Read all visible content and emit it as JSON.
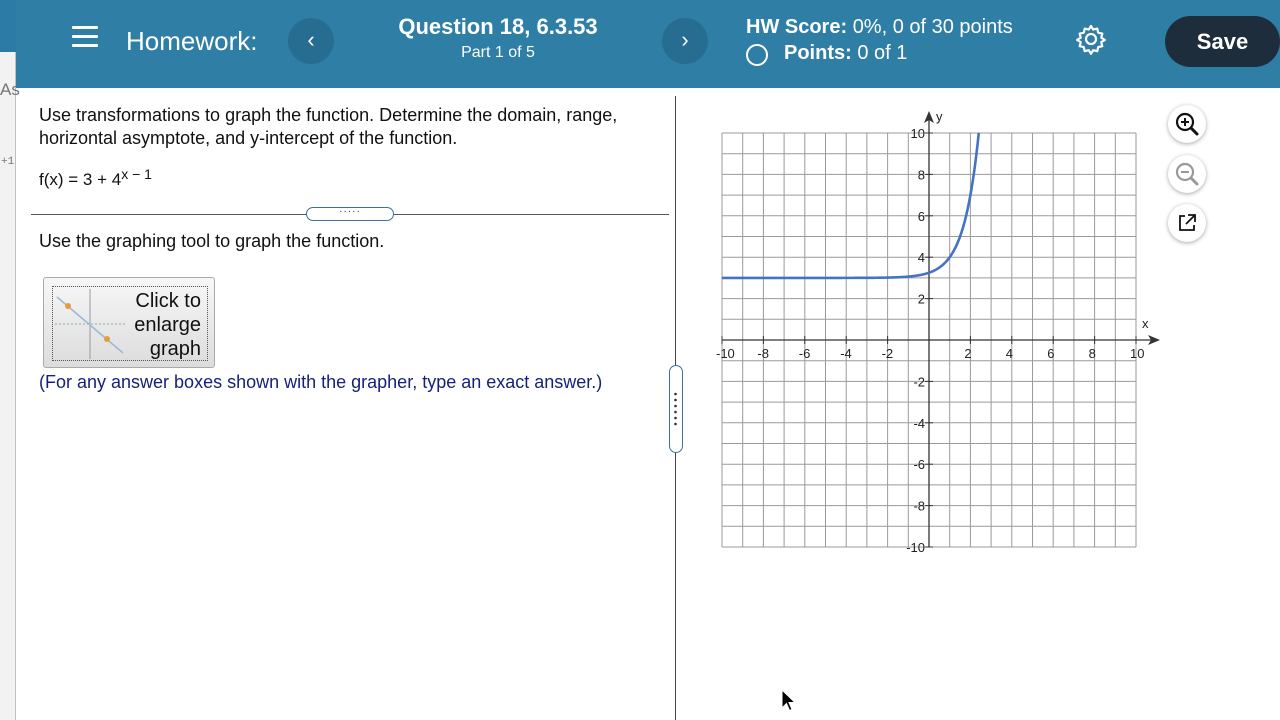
{
  "edge": {
    "left_text_1": "As",
    "left_text_2": "+1"
  },
  "header": {
    "homework_label": "Homework:",
    "prev_glyph": "‹",
    "next_glyph": "›",
    "question_title": "Question 18, 6.3.53",
    "question_part": "Part 1 of 5",
    "hw_score_label": "HW Score:",
    "hw_score_value": "0%, 0 of 30 points",
    "points_label": "Points:",
    "points_value": "0 of 1",
    "save_label": "Save"
  },
  "question": {
    "prompt": "Use transformations to graph the function. Determine the domain, range, horizontal asymptote, and y-intercept of the function.",
    "function_base": "f(x) = 3 + 4",
    "function_exponent": "x − 1",
    "instruction": "Use the graphing tool to graph the function.",
    "enlarge_label": "Click to enlarge graph",
    "note": "(For any answer boxes shown with the grapher, type an exact answer.)"
  },
  "graph": {
    "x_axis_label": "x",
    "y_axis_label": "y",
    "xlim": [
      -10,
      10
    ],
    "ylim": [
      -10,
      10
    ],
    "grid_step": 1,
    "grid": true,
    "x_tick_labels": [
      "-10",
      "-8",
      "-6",
      "-4",
      "-2",
      "2",
      "4",
      "6",
      "8",
      "10"
    ],
    "y_tick_labels": [
      "10",
      "8",
      "6",
      "4",
      "2",
      "-2",
      "-4",
      "-6",
      "-8",
      "-10"
    ],
    "curve_function": "f(x) = 3 + 4^(x − 1)",
    "curve_color": "#4472c4"
  },
  "tools": {
    "zoom_in_icon": "zoom-in-icon",
    "zoom_out_icon": "zoom-out-icon",
    "popout_icon": "external-link-icon"
  },
  "colors": {
    "header_bg": "#2e7ea6",
    "save_bg": "#1e2d3b",
    "note_text": "#17207a"
  }
}
